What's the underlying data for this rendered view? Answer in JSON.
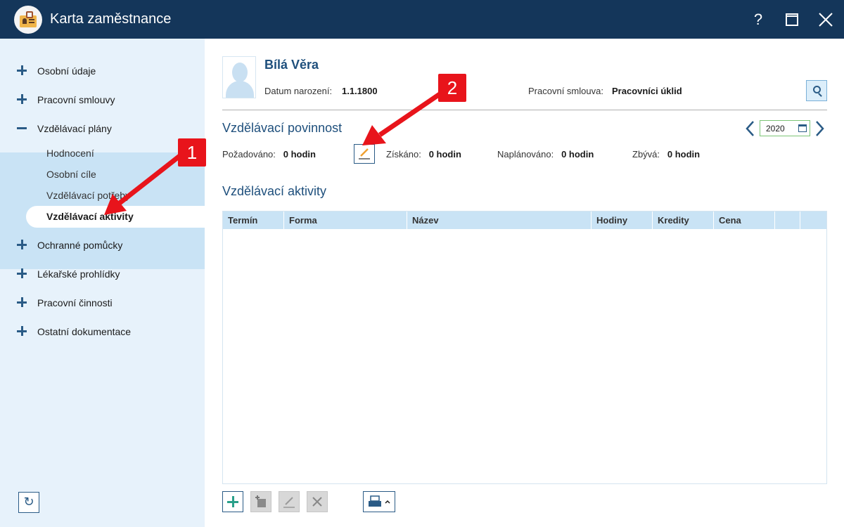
{
  "window": {
    "title": "Karta zaměstnance",
    "help_glyph": "?",
    "maximize_glyph": "☐",
    "close_glyph": "✕"
  },
  "sidebar": {
    "items": [
      {
        "label": "Osobní údaje",
        "state": "collapsed"
      },
      {
        "label": "Pracovní smlouvy",
        "state": "collapsed"
      },
      {
        "label": "Vzdělávací plány",
        "state": "expanded"
      },
      {
        "label": "Ochranné pomůcky",
        "state": "collapsed"
      },
      {
        "label": "Lékařské prohlídky",
        "state": "collapsed"
      },
      {
        "label": "Pracovní činnosti",
        "state": "collapsed"
      },
      {
        "label": "Ostatní dokumentace",
        "state": "collapsed"
      }
    ],
    "sub_items": [
      {
        "label": "Hodnocení",
        "active": false
      },
      {
        "label": "Osobní cíle",
        "active": false
      },
      {
        "label": "Vzdělávací potřeby",
        "active": false
      },
      {
        "label": "Vzdělávací aktivity",
        "active": true
      }
    ],
    "refresh_glyph": "↻"
  },
  "employee": {
    "name": "Bílá Věra",
    "birth_label": "Datum narození:",
    "birth_value": "1.1.1800",
    "contract_label": "Pracovní smlouva:",
    "contract_value": "Pracovníci úklid"
  },
  "obligation": {
    "title": "Vzdělávací povinnost",
    "year": "2020",
    "stats": [
      {
        "label": "Požadováno:",
        "value": "0 hodin"
      },
      {
        "label": "Získáno:",
        "value": "0 hodin"
      },
      {
        "label": "Naplánováno:",
        "value": "0 hodin"
      },
      {
        "label": "Zbývá:",
        "value": "0 hodin"
      }
    ]
  },
  "activities": {
    "title": "Vzdělávací aktivity",
    "columns": [
      "Termín",
      "Forma",
      "Název",
      "Hodiny",
      "Kredity",
      "Cena",
      "",
      ""
    ],
    "rows": []
  },
  "annotations": {
    "callout1": "1",
    "callout2": "2",
    "color": "#e8141b"
  },
  "colors": {
    "titlebar": "#14365a",
    "sidebar": "#e7f2fb",
    "sidebar_expanded": "#c9e3f5",
    "heading": "#1e4f7c",
    "accent_add": "#2aa08a"
  }
}
